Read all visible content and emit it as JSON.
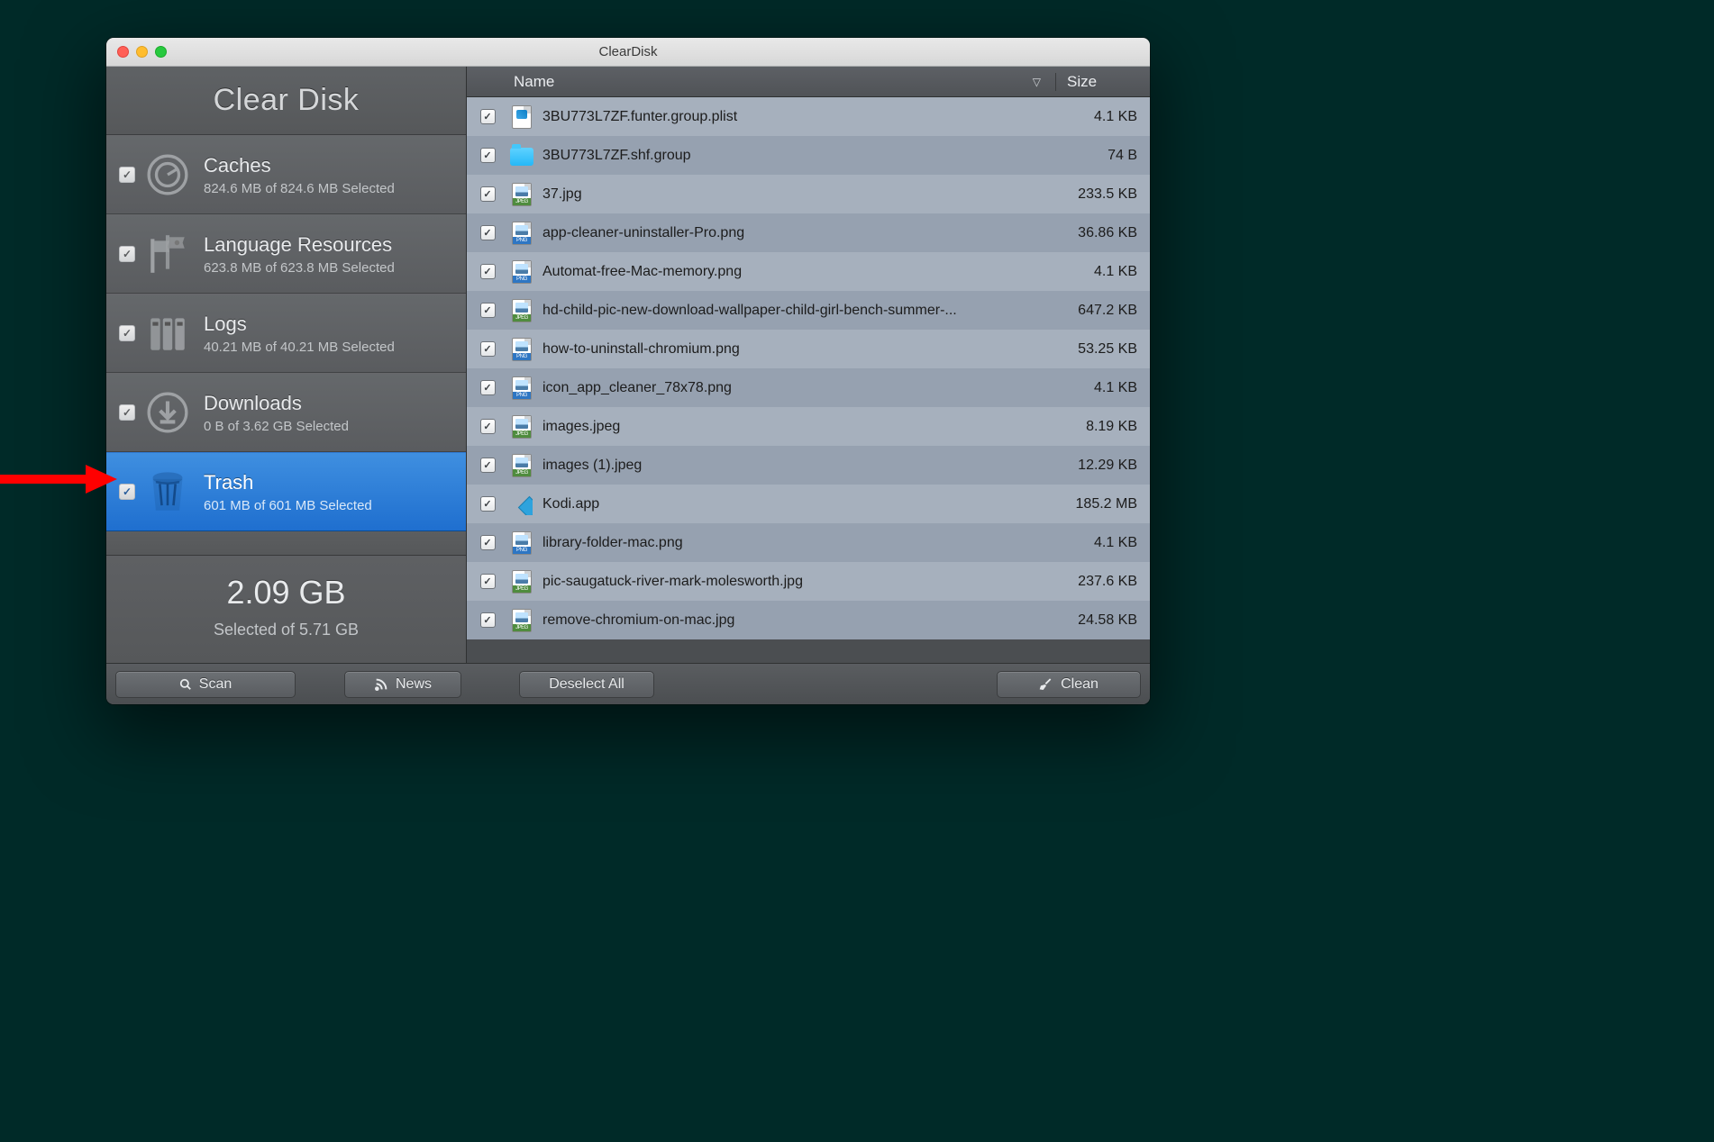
{
  "window_title": "ClearDisk",
  "sidebar_title": "Clear Disk",
  "categories": [
    {
      "name": "Caches",
      "sub": "824.6 MB of 824.6 MB Selected",
      "icon": "gauge",
      "active": false
    },
    {
      "name": "Language Resources",
      "sub": "623.8 MB of 623.8 MB Selected",
      "icon": "flags",
      "active": false
    },
    {
      "name": "Logs",
      "sub": "40.21 MB of 40.21 MB Selected",
      "icon": "binders",
      "active": false
    },
    {
      "name": "Downloads",
      "sub": "0 B of 3.62 GB Selected",
      "icon": "download",
      "active": false
    },
    {
      "name": "Trash",
      "sub": "601 MB of 601 MB Selected",
      "icon": "trash",
      "active": true
    }
  ],
  "summary": {
    "big": "2.09 GB",
    "sub": "Selected of 5.71 GB"
  },
  "columns": {
    "name": "Name",
    "size": "Size"
  },
  "files": [
    {
      "name": "3BU773L7ZF.funter.group.plist",
      "size": "4.1 KB",
      "icon": "plist"
    },
    {
      "name": "3BU773L7ZF.shf.group",
      "size": "74 B",
      "icon": "folder"
    },
    {
      "name": "37.jpg",
      "size": "233.5 KB",
      "icon": "jpeg"
    },
    {
      "name": "app-cleaner-uninstaller-Pro.png",
      "size": "36.86 KB",
      "icon": "png"
    },
    {
      "name": "Automat-free-Mac-memory.png",
      "size": "4.1 KB",
      "icon": "png"
    },
    {
      "name": "hd-child-pic-new-download-wallpaper-child-girl-bench-summer-...",
      "size": "647.2 KB",
      "icon": "jpeg"
    },
    {
      "name": "how-to-uninstall-chromium.png",
      "size": "53.25 KB",
      "icon": "png"
    },
    {
      "name": "icon_app_cleaner_78x78.png",
      "size": "4.1 KB",
      "icon": "png"
    },
    {
      "name": "images.jpeg",
      "size": "8.19 KB",
      "icon": "jpeg"
    },
    {
      "name": "images (1).jpeg",
      "size": "12.29 KB",
      "icon": "jpeg"
    },
    {
      "name": "Kodi.app",
      "size": "185.2 MB",
      "icon": "kodi"
    },
    {
      "name": "library-folder-mac.png",
      "size": "4.1 KB",
      "icon": "png"
    },
    {
      "name": "pic-saugatuck-river-mark-molesworth.jpg",
      "size": "237.6 KB",
      "icon": "jpeg"
    },
    {
      "name": "remove-chromium-on-mac.jpg",
      "size": "24.58 KB",
      "icon": "jpeg"
    }
  ],
  "buttons": {
    "scan": "Scan",
    "news": "News",
    "deselect": "Deselect All",
    "clean": "Clean"
  }
}
